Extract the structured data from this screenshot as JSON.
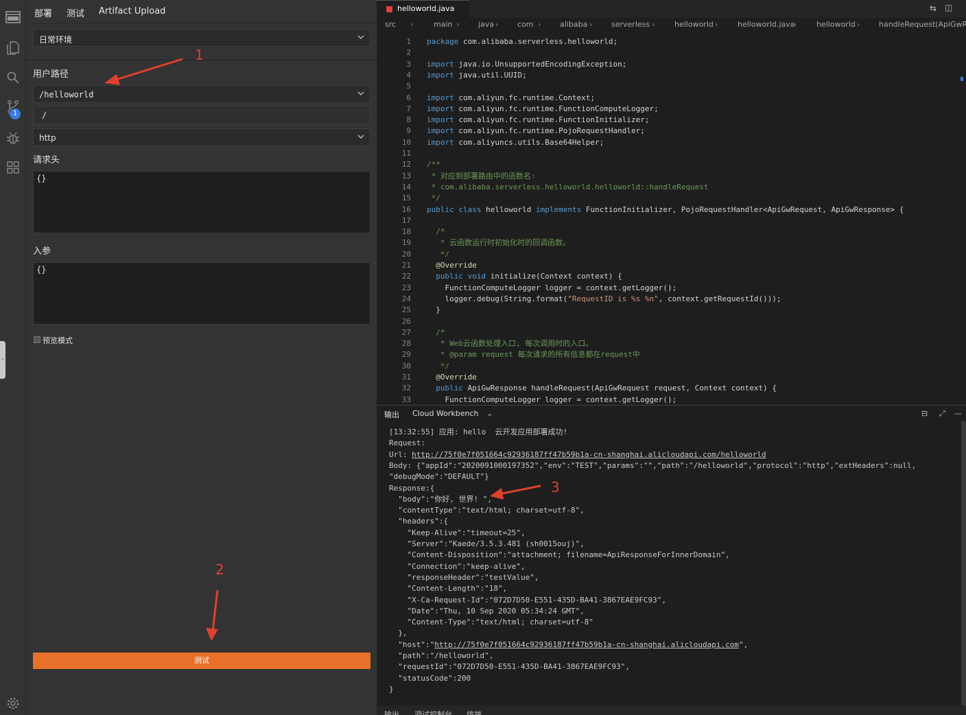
{
  "sidebar_tabs": [
    "部署",
    "测试",
    "Artifact Upload"
  ],
  "form": {
    "env_select": "日常环境",
    "user_path_label": "用户路径",
    "path_select": "/helloworld",
    "path_input": "/",
    "protocol_select": "http",
    "headers_label": "请求头",
    "headers_value": "{}",
    "params_label": "入参",
    "params_value": "{}",
    "preview_label": "预览模式",
    "run_button": "测试"
  },
  "activity_badge": "1",
  "editor": {
    "tab": "helloworld.java",
    "breadcrumbs": [
      "src",
      "main",
      "java",
      "com",
      "alibaba",
      "serverless",
      "helloworld",
      "helloworld.java",
      "helloworld",
      "handleRequest(ApiGwRe"
    ]
  },
  "code_lines": [
    "package com.alibaba.serverless.helloworld;",
    "",
    "import java.io.UnsupportedEncodingException;",
    "import java.util.UUID;",
    "",
    "import com.aliyun.fc.runtime.Context;",
    "import com.aliyun.fc.runtime.FunctionComputeLogger;",
    "import com.aliyun.fc.runtime.FunctionInitializer;",
    "import com.aliyun.fc.runtime.PojoRequestHandler;",
    "import com.aliyuncs.utils.Base64Helper;",
    "",
    "/**",
    " * 对应到部署路由中的函数名:",
    " * com.alibaba.serverless.helloworld.helloworld::handleRequest",
    " */",
    "public class helloworld implements FunctionInitializer, PojoRequestHandler<ApiGwRequest, ApiGwResponse> {",
    "",
    "  /*",
    "   * 云函数运行时初始化时的回调函数。",
    "   */",
    "  @Override",
    "  public void initialize(Context context) {",
    "    FunctionComputeLogger logger = context.getLogger();",
    "    logger.debug(String.format(\"RequestID is %s %n\", context.getRequestId()));",
    "  }",
    "",
    "  /*",
    "   * Web云函数处理入口, 每次调用时的入口。",
    "   * @param request 每次请求的所有信息都在request中",
    "   */",
    "  @Override",
    "  public ApiGwResponse handleRequest(ApiGwRequest request, Context context) {",
    "    FunctionComputeLogger logger = context.getLogger();"
  ],
  "panel_tabs": [
    "输出",
    "Cloud Workbench"
  ],
  "output_lines": [
    "[13:32:55] 应用: hello  云开发应用部署成功!",
    "Request:",
    "Url: http://75f0e7f051664c92936187ff47b59b1a-cn-shanghai.alicloudapi.com/helloworld",
    "Body: {\"appId\":\"2020091000197352\",\"env\":\"TEST\",\"params\":\"\",\"path\":\"/helloworld\",\"protocol\":\"http\",\"extHeaders\":null,",
    "\"debugMode\":\"DEFAULT\"}",
    "Response:{",
    "  \"body\":\"你好, 世界! \",",
    "  \"contentType\":\"text/html; charset=utf-8\",",
    "  \"headers\":{",
    "    \"Keep-Alive\":\"timeout=25\",",
    "    \"Server\":\"Kaede/3.5.3.481 (sh0015ouj)\",",
    "    \"Content-Disposition\":\"attachment; filename=ApiResponseForInnerDomain\",",
    "    \"Connection\":\"keep-alive\",",
    "    \"responseHeader\":\"testValue\",",
    "    \"Content-Length\":\"18\",",
    "    \"X-Ca-Request-Id\":\"072D7D50-E551-435D-BA41-3867EAE9FC93\",",
    "    \"Date\":\"Thu, 10 Sep 2020 05:34:24 GMT\",",
    "    \"Content-Type\":\"text/html; charset=utf-8\"",
    "  },",
    "  \"host\":\"http://75f0e7f051664c92936187ff47b59b1a-cn-shanghai.alicloudapi.com\",",
    "  \"path\":\"/helloworld\",",
    "  \"requestId\":\"072D7D50-E551-435D-BA41-3867EAE9FC93\",",
    "  \"statusCode\":200",
    "}"
  ],
  "bottom_tabs": [
    "输出",
    "调试控制台",
    "终端"
  ],
  "annotations": [
    "1",
    "2",
    "3"
  ],
  "colors": {
    "accent": "#e8702a",
    "annotation": "#e0402f",
    "badge": "#3a7be0"
  }
}
